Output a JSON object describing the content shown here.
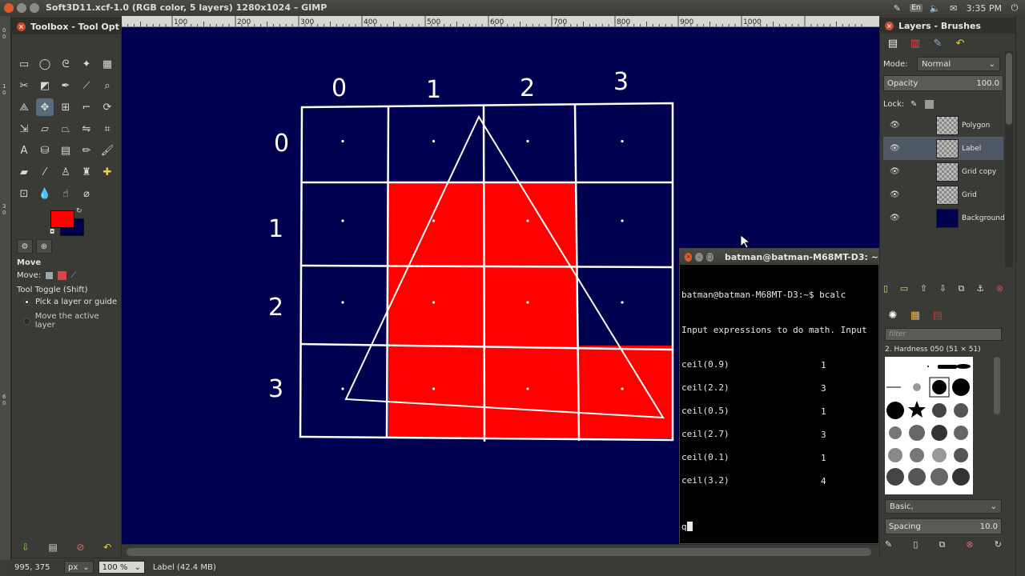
{
  "window": {
    "title": "Soft3D11.xcf-1.0 (RGB color, 5 layers) 1280x1024 – GIMP"
  },
  "system_tray": {
    "keyboard_layout": "En",
    "clock": "3:35 PM"
  },
  "toolbox": {
    "title": "Toolbox - Tool Opt",
    "fg_color": "#ff0000",
    "bg_color": "#000050",
    "tool_options": {
      "tool_name": "Move",
      "move_label": "Move:",
      "toggle_label": "Tool Toggle  (Shift)",
      "options": [
        {
          "label": "Pick a layer or guide",
          "selected": true
        },
        {
          "label": "Move the active layer",
          "selected": false
        }
      ]
    }
  },
  "ruler": {
    "labels": [
      "100",
      "200",
      "300",
      "400",
      "500",
      "600",
      "700",
      "800",
      "900",
      "1000"
    ]
  },
  "canvas": {
    "background_color": "#000050",
    "column_labels": [
      "0",
      "1",
      "2",
      "3"
    ],
    "row_labels": [
      "0",
      "1",
      "2",
      "3"
    ],
    "filled_cells": [
      [
        1,
        1
      ],
      [
        1,
        2
      ],
      [
        2,
        1
      ],
      [
        2,
        2
      ],
      [
        3,
        1
      ],
      [
        3,
        2
      ],
      [
        3,
        3
      ]
    ],
    "fill_color": "#ff0000"
  },
  "terminal": {
    "title": "batman@batman-M68MT-D3: ~",
    "prompt_line": "batman@batman-M68MT-D3:~$ bcalc",
    "intro_line": "Input expressions to do math. Input",
    "entries": [
      {
        "expr": "ceil(0.9)",
        "result": "1"
      },
      {
        "expr": "ceil(2.2)",
        "result": "3"
      },
      {
        "expr": "ceil(0.5)",
        "result": "1"
      },
      {
        "expr": "ceil(2.7)",
        "result": "3"
      },
      {
        "expr": "ceil(0.1)",
        "result": "1"
      },
      {
        "expr": "ceil(3.2)",
        "result": "4"
      }
    ],
    "current_input": "q"
  },
  "layers_dock": {
    "title": "Layers - Brushes",
    "mode_label": "Mode:",
    "mode_value": "Normal",
    "opacity_label": "Opacity",
    "opacity_value": "100.0",
    "lock_label": "Lock:",
    "layers": [
      {
        "name": "Polygon",
        "selected": false
      },
      {
        "name": "Label",
        "selected": true
      },
      {
        "name": "Grid copy",
        "selected": false
      },
      {
        "name": "Grid",
        "selected": false
      },
      {
        "name": "Background",
        "selected": false
      }
    ]
  },
  "brushes": {
    "filter_placeholder": "filter",
    "current_brush": "2. Hardness 050 (51 × 51)",
    "preset": "Basic,",
    "spacing_label": "Spacing",
    "spacing_value": "10.0"
  },
  "statusbar": {
    "coords": "995, 375",
    "unit": "px",
    "zoom": "100 %",
    "status": "Label (42.4 MB)"
  }
}
